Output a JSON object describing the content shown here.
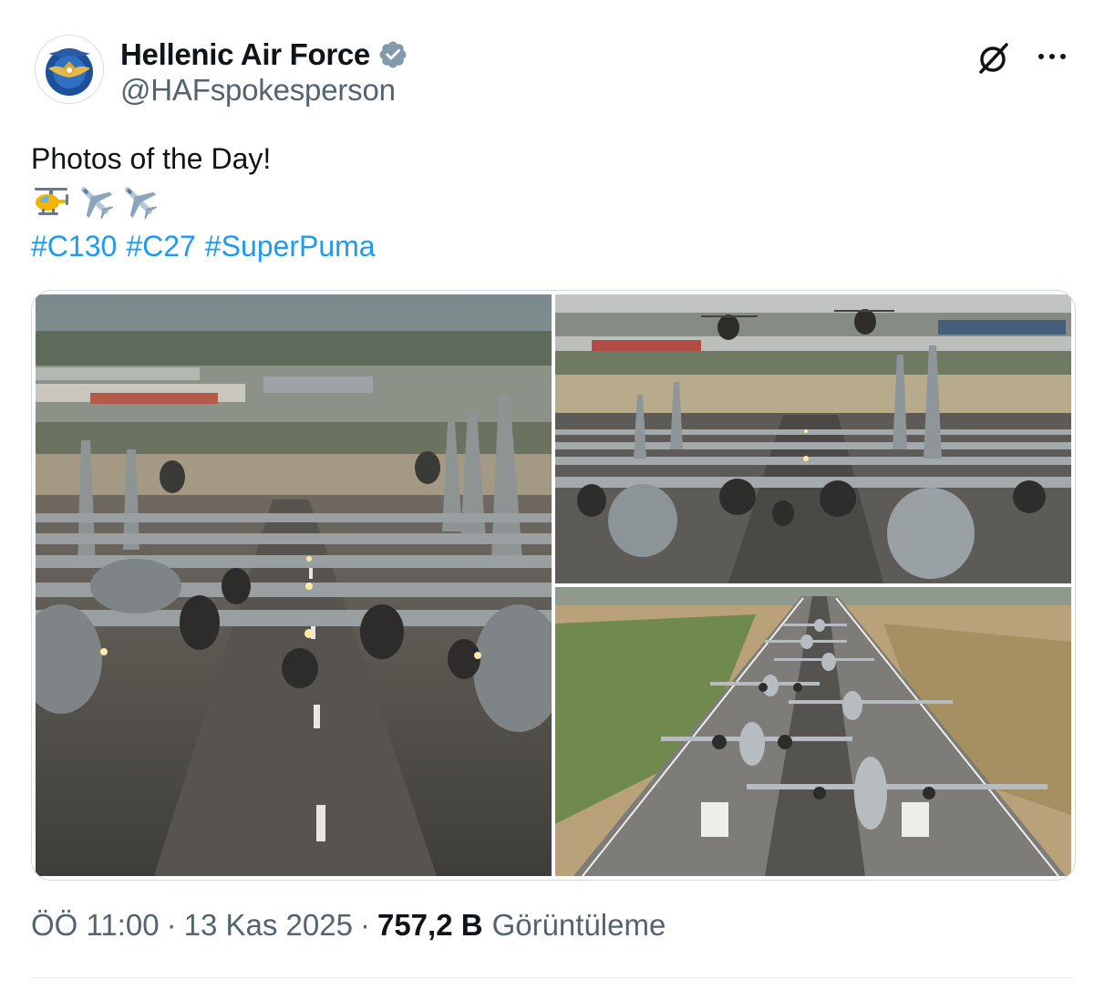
{
  "author": {
    "display_name": "Hellenic Air Force",
    "handle": "@HAFspokesperson",
    "avatar_icon": "hellenic-air-force-emblem",
    "verified_icon": "verified-badge-icon"
  },
  "actions": {
    "grok_icon": "grok-icon",
    "more_icon": "more-options-icon"
  },
  "post": {
    "text": "Photos of the Day!",
    "emojis": [
      "helicopter",
      "airplane",
      "airplane"
    ],
    "hashtags": [
      "#C130",
      "#C27",
      "#SuperPuma"
    ]
  },
  "media": {
    "photos": [
      {
        "subject": "C-130 and C-27 aircraft lined up on runway with Super Puma helicopters, low angle view"
      },
      {
        "subject": "Elephant walk of transport aircraft with two helicopters hovering above"
      },
      {
        "subject": "Aerial view of aircraft taxiing in formation on runway"
      }
    ]
  },
  "meta": {
    "time": "ÖÖ 11:00",
    "date": "13 Kas 2025",
    "views_count": "757,2 B",
    "views_label": "Görüntüleme",
    "separator": "·"
  },
  "colors": {
    "link": "#1d9bf0",
    "verified": "#829aab",
    "secondary_text": "#536471",
    "primary_text": "#0f1419"
  }
}
